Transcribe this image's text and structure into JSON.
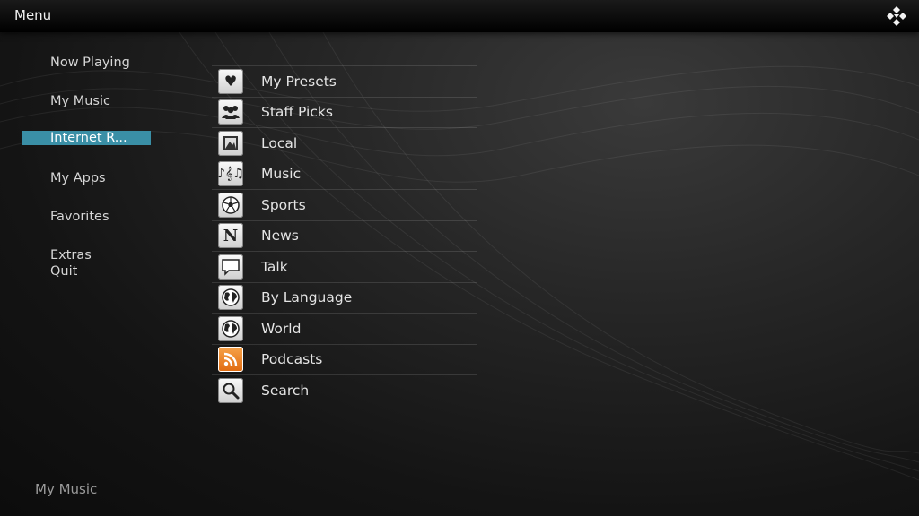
{
  "header": {
    "title": "Menu",
    "logo_icon": "kodi-logo-icon"
  },
  "left_menu": [
    {
      "label": "Now Playing"
    },
    {
      "label": "My Music"
    },
    {
      "label": "Internet R..."
    },
    {
      "label": "My Apps"
    },
    {
      "label": "Favorites"
    },
    {
      "label": "Extras"
    },
    {
      "label": "Quit"
    }
  ],
  "selected_left": "Internet R...",
  "categories": [
    {
      "label": "My Presets",
      "icon": "heart-icon"
    },
    {
      "label": "Staff Picks",
      "icon": "people-icon"
    },
    {
      "label": "Local",
      "icon": "local-icon"
    },
    {
      "label": "Music",
      "icon": "music-notes-icon"
    },
    {
      "label": "Sports",
      "icon": "soccer-ball-icon"
    },
    {
      "label": "News",
      "icon": "newspaper-icon"
    },
    {
      "label": "Talk",
      "icon": "speech-bubble-icon"
    },
    {
      "label": "By Language",
      "icon": "globe-icon"
    },
    {
      "label": "World",
      "icon": "globe-icon"
    },
    {
      "label": "Podcasts",
      "icon": "rss-icon"
    },
    {
      "label": "Search",
      "icon": "search-icon"
    }
  ],
  "footer": {
    "text": "My Music"
  },
  "colors": {
    "selection": "#3a8fa6",
    "background": "#1c1c1c"
  }
}
